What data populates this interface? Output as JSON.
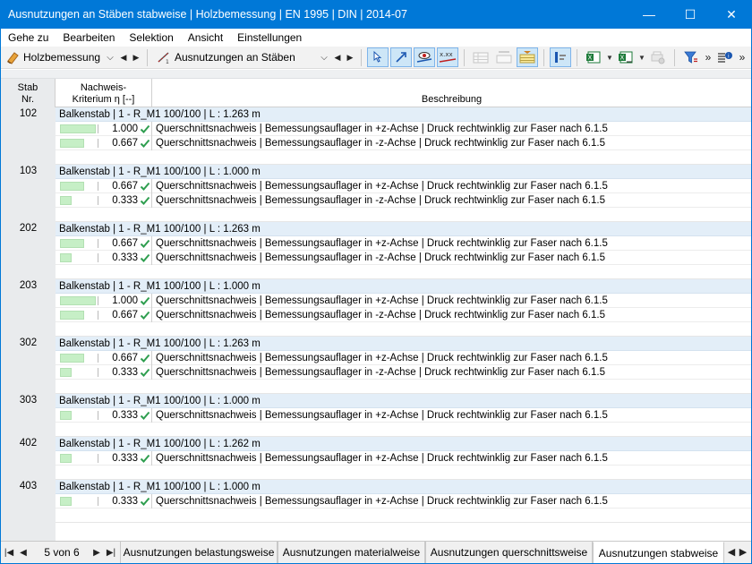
{
  "window": {
    "title": "Ausnutzungen an Stäben stabweise | Holzbemessung | EN 1995 | DIN | 2014-07",
    "minimize": "—",
    "maximize": "☐",
    "close": "✕"
  },
  "menu": [
    "Gehe zu",
    "Bearbeiten",
    "Selektion",
    "Ansicht",
    "Einstellungen"
  ],
  "toolbar": {
    "module_combo": "Holzbemessung",
    "result_combo": "Ausnutzungen an Stäben",
    "more1": "»",
    "more2": "»"
  },
  "columns": {
    "stab": "Stab\nNr.",
    "nachweis": "Nachweis-\nKriterium η [--]",
    "beschreibung": "Beschreibung"
  },
  "groups": [
    {
      "stab": "102",
      "header": "Balkenstab | 1 - R_M1 100/100 | L : 1.263 m",
      "rows": [
        {
          "value": "1.000",
          "ratio": 1.0,
          "desc": "Querschnittsnachweis | Bemessungsauflager in +z-Achse | Druck rechtwinklig zur Faser nach 6.1.5"
        },
        {
          "value": "0.667",
          "ratio": 0.667,
          "desc": "Querschnittsnachweis | Bemessungsauflager in -z-Achse | Druck rechtwinklig zur Faser nach 6.1.5"
        }
      ]
    },
    {
      "stab": "103",
      "header": "Balkenstab | 1 - R_M1 100/100 | L : 1.000 m",
      "rows": [
        {
          "value": "0.667",
          "ratio": 0.667,
          "desc": "Querschnittsnachweis | Bemessungsauflager in +z-Achse | Druck rechtwinklig zur Faser nach 6.1.5"
        },
        {
          "value": "0.333",
          "ratio": 0.333,
          "desc": "Querschnittsnachweis | Bemessungsauflager in -z-Achse | Druck rechtwinklig zur Faser nach 6.1.5"
        }
      ]
    },
    {
      "stab": "202",
      "header": "Balkenstab | 1 - R_M1 100/100 | L : 1.263 m",
      "rows": [
        {
          "value": "0.667",
          "ratio": 0.667,
          "desc": "Querschnittsnachweis | Bemessungsauflager in +z-Achse | Druck rechtwinklig zur Faser nach 6.1.5"
        },
        {
          "value": "0.333",
          "ratio": 0.333,
          "desc": "Querschnittsnachweis | Bemessungsauflager in -z-Achse | Druck rechtwinklig zur Faser nach 6.1.5"
        }
      ]
    },
    {
      "stab": "203",
      "header": "Balkenstab | 1 - R_M1 100/100 | L : 1.000 m",
      "rows": [
        {
          "value": "1.000",
          "ratio": 1.0,
          "desc": "Querschnittsnachweis | Bemessungsauflager in +z-Achse | Druck rechtwinklig zur Faser nach 6.1.5"
        },
        {
          "value": "0.667",
          "ratio": 0.667,
          "desc": "Querschnittsnachweis | Bemessungsauflager in -z-Achse | Druck rechtwinklig zur Faser nach 6.1.5"
        }
      ]
    },
    {
      "stab": "302",
      "header": "Balkenstab | 1 - R_M1 100/100 | L : 1.263 m",
      "rows": [
        {
          "value": "0.667",
          "ratio": 0.667,
          "desc": "Querschnittsnachweis | Bemessungsauflager in +z-Achse | Druck rechtwinklig zur Faser nach 6.1.5"
        },
        {
          "value": "0.333",
          "ratio": 0.333,
          "desc": "Querschnittsnachweis | Bemessungsauflager in -z-Achse | Druck rechtwinklig zur Faser nach 6.1.5"
        }
      ]
    },
    {
      "stab": "303",
      "header": "Balkenstab | 1 - R_M1 100/100 | L : 1.000 m",
      "rows": [
        {
          "value": "0.333",
          "ratio": 0.333,
          "desc": "Querschnittsnachweis | Bemessungsauflager in +z-Achse | Druck rechtwinklig zur Faser nach 6.1.5"
        }
      ]
    },
    {
      "stab": "402",
      "header": "Balkenstab | 1 - R_M1 100/100 | L : 1.262 m",
      "rows": [
        {
          "value": "0.333",
          "ratio": 0.333,
          "desc": "Querschnittsnachweis | Bemessungsauflager in +z-Achse | Druck rechtwinklig zur Faser nach 6.1.5"
        }
      ]
    },
    {
      "stab": "403",
      "header": "Balkenstab | 1 - R_M1 100/100 | L : 1.000 m",
      "rows": [
        {
          "value": "0.333",
          "ratio": 0.333,
          "desc": "Querschnittsnachweis | Bemessungsauflager in +z-Achse | Druck rechtwinklig zur Faser nach 6.1.5"
        }
      ]
    }
  ],
  "tabs": {
    "counter": "5 von 6",
    "items": [
      {
        "label": "Ausnutzungen belastungsweise",
        "active": false
      },
      {
        "label": "Ausnutzungen materialweise",
        "active": false
      },
      {
        "label": "Ausnutzungen querschnittsweise",
        "active": false
      },
      {
        "label": "Ausnutzungen stabweise",
        "active": true
      }
    ]
  },
  "colors": {
    "titlebar": "#0078d7",
    "bar_fill": "#c6efc6",
    "check": "#2e9e4f",
    "group_header": "#e3eef8"
  }
}
